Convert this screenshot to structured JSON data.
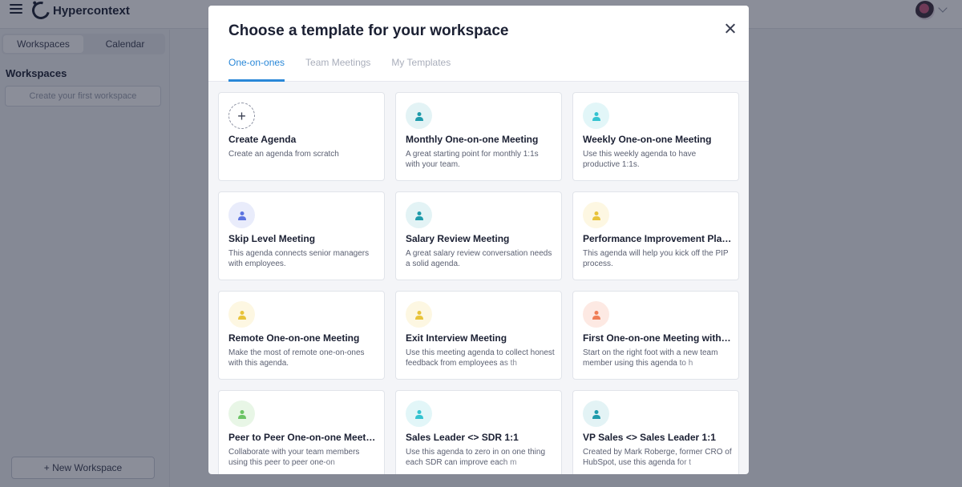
{
  "app": {
    "name": "Hypercontext",
    "sidebar": {
      "tabs": [
        "Workspaces",
        "Calendar"
      ],
      "title": "Workspaces",
      "create_first": "Create your first workspace",
      "new_workspace": "+ New Workspace"
    }
  },
  "modal": {
    "title": "Choose a template for your workspace",
    "tabs": [
      {
        "label": "One-on-ones",
        "active": true
      },
      {
        "label": "Team Meetings",
        "active": false
      },
      {
        "label": "My Templates",
        "active": false
      }
    ],
    "cards": [
      {
        "title": "Create Agenda",
        "desc": "Create an agenda from scratch",
        "icon": "plus-icon",
        "bg": "#ffffff",
        "fg": "#3a3f52"
      },
      {
        "title": "Monthly One-on-one Meeting",
        "desc": "A great starting point for monthly 1:1s with your team.",
        "icon": "person-icon",
        "bg": "#e3f3f5",
        "fg": "#1f9bab"
      },
      {
        "title": "Weekly One-on-one Meeting",
        "desc": "Use this weekly agenda to have productive 1:1s.",
        "icon": "person-icon",
        "bg": "#e2f6f8",
        "fg": "#34c3d0"
      },
      {
        "title": "Skip Level Meeting",
        "desc": "This agenda connects senior managers with employees.",
        "icon": "person-icon",
        "bg": "#e9ecfb",
        "fg": "#5c73e0"
      },
      {
        "title": "Salary Review Meeting",
        "desc": "A great salary review conversation needs a solid agenda.",
        "icon": "person-icon",
        "bg": "#e3f3f5",
        "fg": "#1f9bab"
      },
      {
        "title": "Performance Improvement Plan M...",
        "desc": "This agenda will help you kick off the PIP process.",
        "icon": "person-icon",
        "bg": "#fdf7e2",
        "fg": "#e8c33a"
      },
      {
        "title": "Remote One-on-one Meeting",
        "desc": "Make the most of remote one-on-ones with this agenda.",
        "icon": "person-icon",
        "bg": "#fdf7e2",
        "fg": "#e8c33a"
      },
      {
        "title": "Exit Interview Meeting",
        "desc": "Use this meeting agenda to collect honest feedback from employees as th",
        "icon": "person-icon",
        "bg": "#fdf7e2",
        "fg": "#e8c33a"
      },
      {
        "title": "First One-on-one Meeting with a N...",
        "desc": "Start on the right foot with a new team member using this agenda to h",
        "icon": "person-icon",
        "bg": "#fde9e3",
        "fg": "#ef7d56"
      },
      {
        "title": "Peer to Peer One-on-one Meeting",
        "desc": "Collaborate with your team members using this peer to peer one-on",
        "icon": "person-icon",
        "bg": "#e8f6e6",
        "fg": "#6cc465"
      },
      {
        "title": "Sales Leader <> SDR 1:1",
        "desc": "Use this agenda to zero in on one thing each SDR can improve each m",
        "icon": "person-icon",
        "bg": "#e2f6f8",
        "fg": "#34c3d0"
      },
      {
        "title": "VP Sales <> Sales Leader 1:1",
        "desc": "Created by Mark Roberge, former CRO of HubSpot, use this agenda for t",
        "icon": "person-icon",
        "bg": "#e3f3f5",
        "fg": "#1f9bab"
      }
    ]
  }
}
